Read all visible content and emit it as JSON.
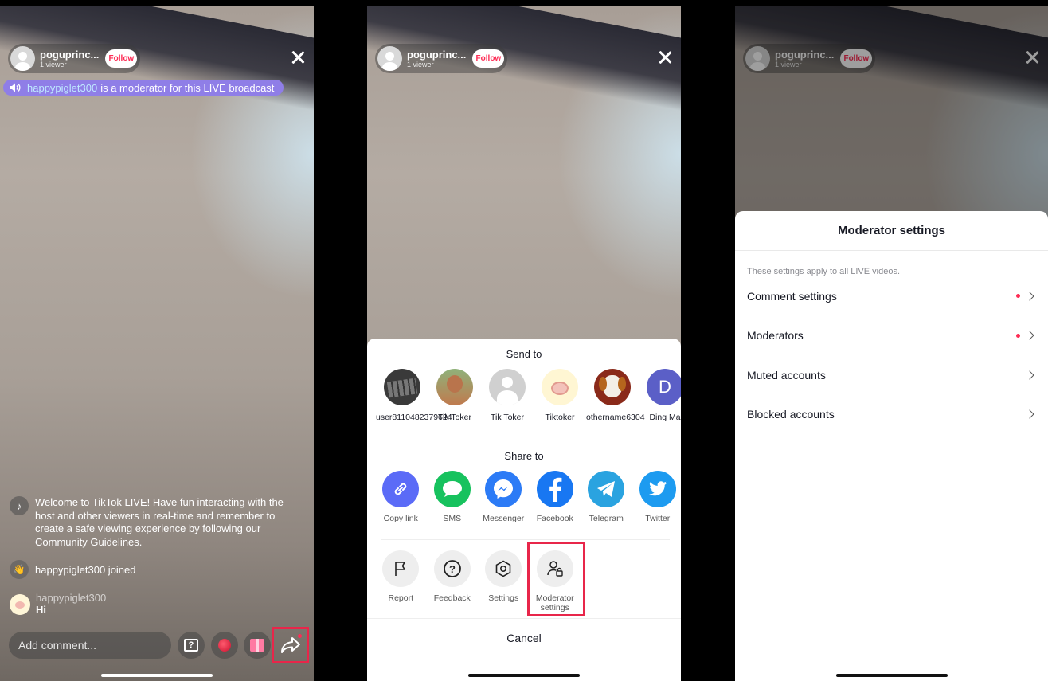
{
  "host": {
    "name": "poguprinc...",
    "viewers": "1 viewer",
    "follow_label": "Follow"
  },
  "banner": {
    "moderator_name": "happypiglet300",
    "text": "is a moderator for this LIVE broadcast"
  },
  "chat": {
    "welcome": "Welcome to TikTok LIVE! Have fun interacting with the host and other viewers in real-time and remember to create a safe viewing experience by following our Community Guidelines.",
    "joined": "happypiglet300 joined",
    "message_user": "happypiglet300",
    "message_text": "Hi"
  },
  "comment_placeholder": "Add comment...",
  "share_sheet": {
    "send_to_title": "Send to",
    "contacts": [
      {
        "label": "user8110482379624"
      },
      {
        "label": "Tik Toker"
      },
      {
        "label": "Tik Toker"
      },
      {
        "label": "Tiktoker"
      },
      {
        "label": "othername6304"
      },
      {
        "label": "Ding Ma",
        "initial": "D"
      }
    ],
    "share_to_title": "Share to",
    "share_targets": [
      {
        "label": "Copy link",
        "color": "#5b6bf7",
        "icon": "link-icon"
      },
      {
        "label": "SMS",
        "color": "#17c25e",
        "icon": "chat-bubble-icon"
      },
      {
        "label": "Messenger",
        "color": "#2c7bf6",
        "icon": "messenger-icon"
      },
      {
        "label": "Facebook",
        "color": "#1877f2",
        "icon": "facebook-icon"
      },
      {
        "label": "Telegram",
        "color": "#2aa3e0",
        "icon": "telegram-icon"
      },
      {
        "label": "Twitter",
        "color": "#1d9bf0",
        "icon": "twitter-icon"
      }
    ],
    "tools": [
      {
        "label": "Report",
        "icon": "flag-icon"
      },
      {
        "label": "Feedback",
        "icon": "question-icon"
      },
      {
        "label": "Settings",
        "icon": "hexagon-settings-icon"
      },
      {
        "label": "Moderator settings",
        "icon": "user-lock-icon"
      }
    ],
    "cancel_label": "Cancel"
  },
  "moderator_settings": {
    "title": "Moderator settings",
    "note": "These settings apply to all LIVE videos.",
    "rows": [
      {
        "label": "Comment settings",
        "has_dot": true
      },
      {
        "label": "Moderators",
        "has_dot": true
      },
      {
        "label": "Muted accounts",
        "has_dot": false
      },
      {
        "label": "Blocked accounts",
        "has_dot": false
      }
    ]
  },
  "colors": {
    "accent": "#fe2c55",
    "highlight_box": "#e8264a",
    "banner": "#8f7ee7"
  }
}
